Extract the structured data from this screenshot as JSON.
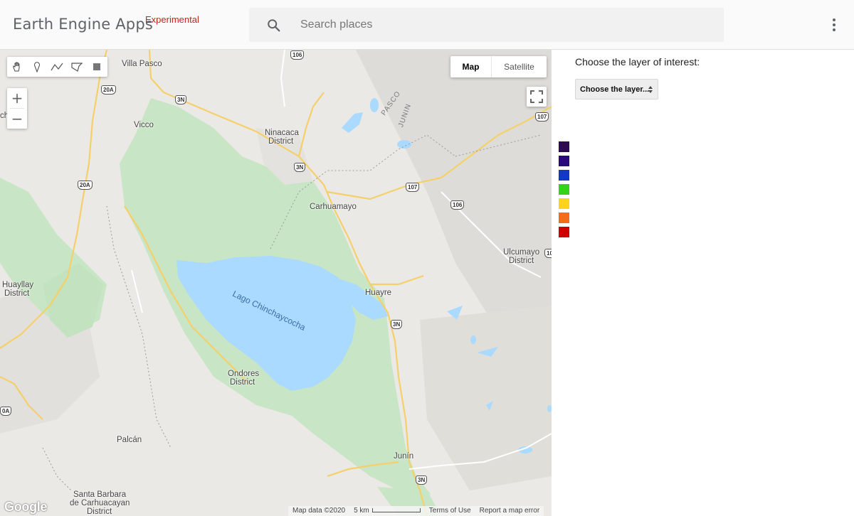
{
  "header": {
    "app_title": "Earth Engine Apps",
    "badge": "Experimental",
    "search_placeholder": "Search places",
    "icons": {
      "search": "search-icon",
      "more": "more-vert-icon"
    }
  },
  "map": {
    "draw_tools": [
      "pan-hand-icon",
      "marker-icon",
      "line-icon",
      "polygon-icon",
      "rectangle-icon"
    ],
    "zoom_in": "+",
    "zoom_out": "−",
    "map_type": {
      "map": "Map",
      "satellite": "Satellite"
    },
    "labels": {
      "villa_pasco": "Villa Pasco",
      "vicco": "Vicco",
      "ninacaca": "Ninacaca",
      "ninacaca_district": "District",
      "carhuamayo": "Carhuamayo",
      "ulcumayo": "Ulcumayo",
      "ulcumayo_district": "District",
      "huayllay": "Huayllay",
      "huayllay_district": "District",
      "huayre": "Huayre",
      "ondores": "Ondores",
      "ondores_district": "District",
      "palcan": "Palcán",
      "junin": "Junín",
      "santa_barbara_1": "Santa Barbara",
      "santa_barbara_2": "de Carhuacayan",
      "santa_barbara_3": "District",
      "lake": "Lago Chinchaycocha",
      "pasco": "PASCO",
      "junin_region": "JUNIN",
      "edge_ch": "ch"
    },
    "shields": {
      "s106a": "106",
      "s20a_1": "20A",
      "s3n_1": "3N",
      "s107a": "107",
      "s3n_2": "3N",
      "s20a_2": "20A",
      "s107b": "107",
      "s106b": "106",
      "s106c": "10",
      "s3n_3": "3N",
      "s0a": "0A",
      "s3n_4": "3N"
    },
    "google": "Google",
    "footer": {
      "map_data": "Map data ©2020",
      "scale": "5 km",
      "terms": "Terms of Use",
      "report": "Report a map error"
    }
  },
  "panel": {
    "prompt": "Choose the layer of interest:",
    "select_value": "Choose the layer...",
    "legend_colors": [
      "#2c0b4f",
      "#2a0a7b",
      "#1437c7",
      "#36d11b",
      "#fbd41b",
      "#f56b1c",
      "#d00000"
    ]
  }
}
